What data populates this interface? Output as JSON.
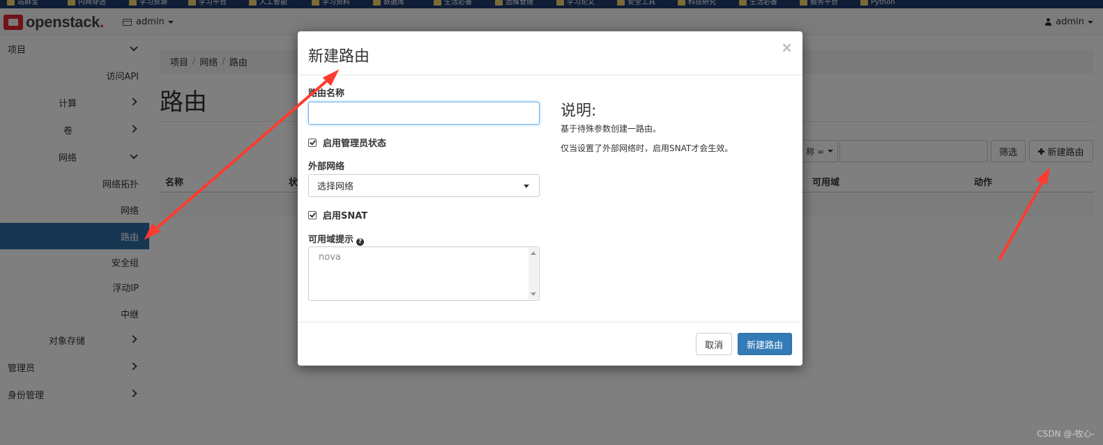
{
  "bookmarks": [
    "站群宝",
    "内网穿透",
    "学习资源",
    "学习平台",
    "人工智能",
    "学习资料",
    "数据库",
    "生活必备",
    "运维管理",
    "学习论文",
    "安全工具",
    "科技研究",
    "生活必备",
    "服务平台",
    "Python"
  ],
  "navbar": {
    "logo_text": "openstack",
    "logo_dot": ".",
    "project_menu_label": "admin",
    "user_menu_label": "admin"
  },
  "sidebar": {
    "items": [
      {
        "label": "项目",
        "chevron": "down"
      },
      {
        "label": "访问API"
      },
      {
        "label": "计算",
        "chevron": "right"
      },
      {
        "label": "卷",
        "chevron": "right"
      },
      {
        "label": "网络",
        "chevron": "down"
      },
      {
        "label": "网络拓扑"
      },
      {
        "label": "网络"
      },
      {
        "label": "路由",
        "active": true
      },
      {
        "label": "安全组"
      },
      {
        "label": "浮动IP"
      },
      {
        "label": "中继"
      },
      {
        "label": "对象存储",
        "chevron": "right"
      },
      {
        "label": "管理员",
        "chevron": "right"
      },
      {
        "label": "身份管理",
        "chevron": "right"
      }
    ]
  },
  "main": {
    "breadcrumb": [
      "项目",
      "网络",
      "路由"
    ],
    "page_title": "路由",
    "filter_select_label": "称 =",
    "filter_button_label": "筛选",
    "create_button_label": "新建路由",
    "table_headers": [
      "名称",
      "状",
      "可用域",
      "动作"
    ]
  },
  "modal": {
    "title": "新建路由",
    "close_label": "×",
    "router_name_label": "路由名称",
    "router_name_value": "",
    "admin_state_label": "启用管理员状态",
    "external_network_label": "外部网络",
    "external_network_selected": "选择网络",
    "enable_snat_label": "启用SNAT",
    "az_hint_label": "可用域提示",
    "az_hint_value": "nova",
    "description_title": "说明:",
    "description_lines": [
      "基于待殊参数创建一路由。",
      "仅当设置了外部网络时，启用SNAT才会生效。"
    ],
    "cancel_label": "取消",
    "submit_label": "新建路由"
  },
  "watermark": "CSDN @-牧心-",
  "colors": {
    "primary": "#337ab7",
    "active_nav": "#2e6da4",
    "brand_red": "#e0282e",
    "annotation_arrow": "#ff3b2f"
  }
}
